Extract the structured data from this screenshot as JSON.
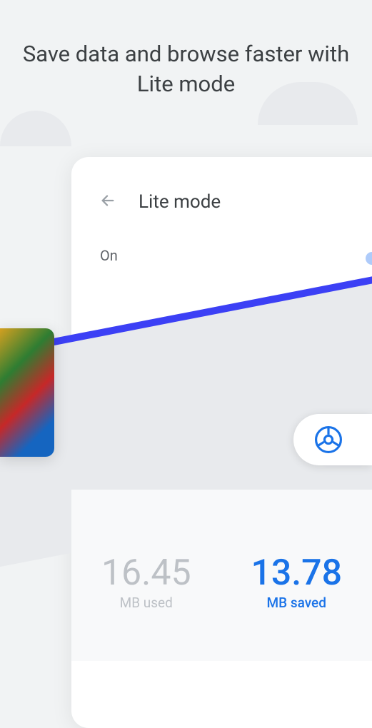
{
  "headline": "Save data and browse faster with Lite mode",
  "card": {
    "title": "Lite mode",
    "toggle_label": "On"
  },
  "stats": {
    "used_value": "16.45",
    "used_label": "MB used",
    "saved_value": "13.78",
    "saved_label": "MB saved"
  }
}
